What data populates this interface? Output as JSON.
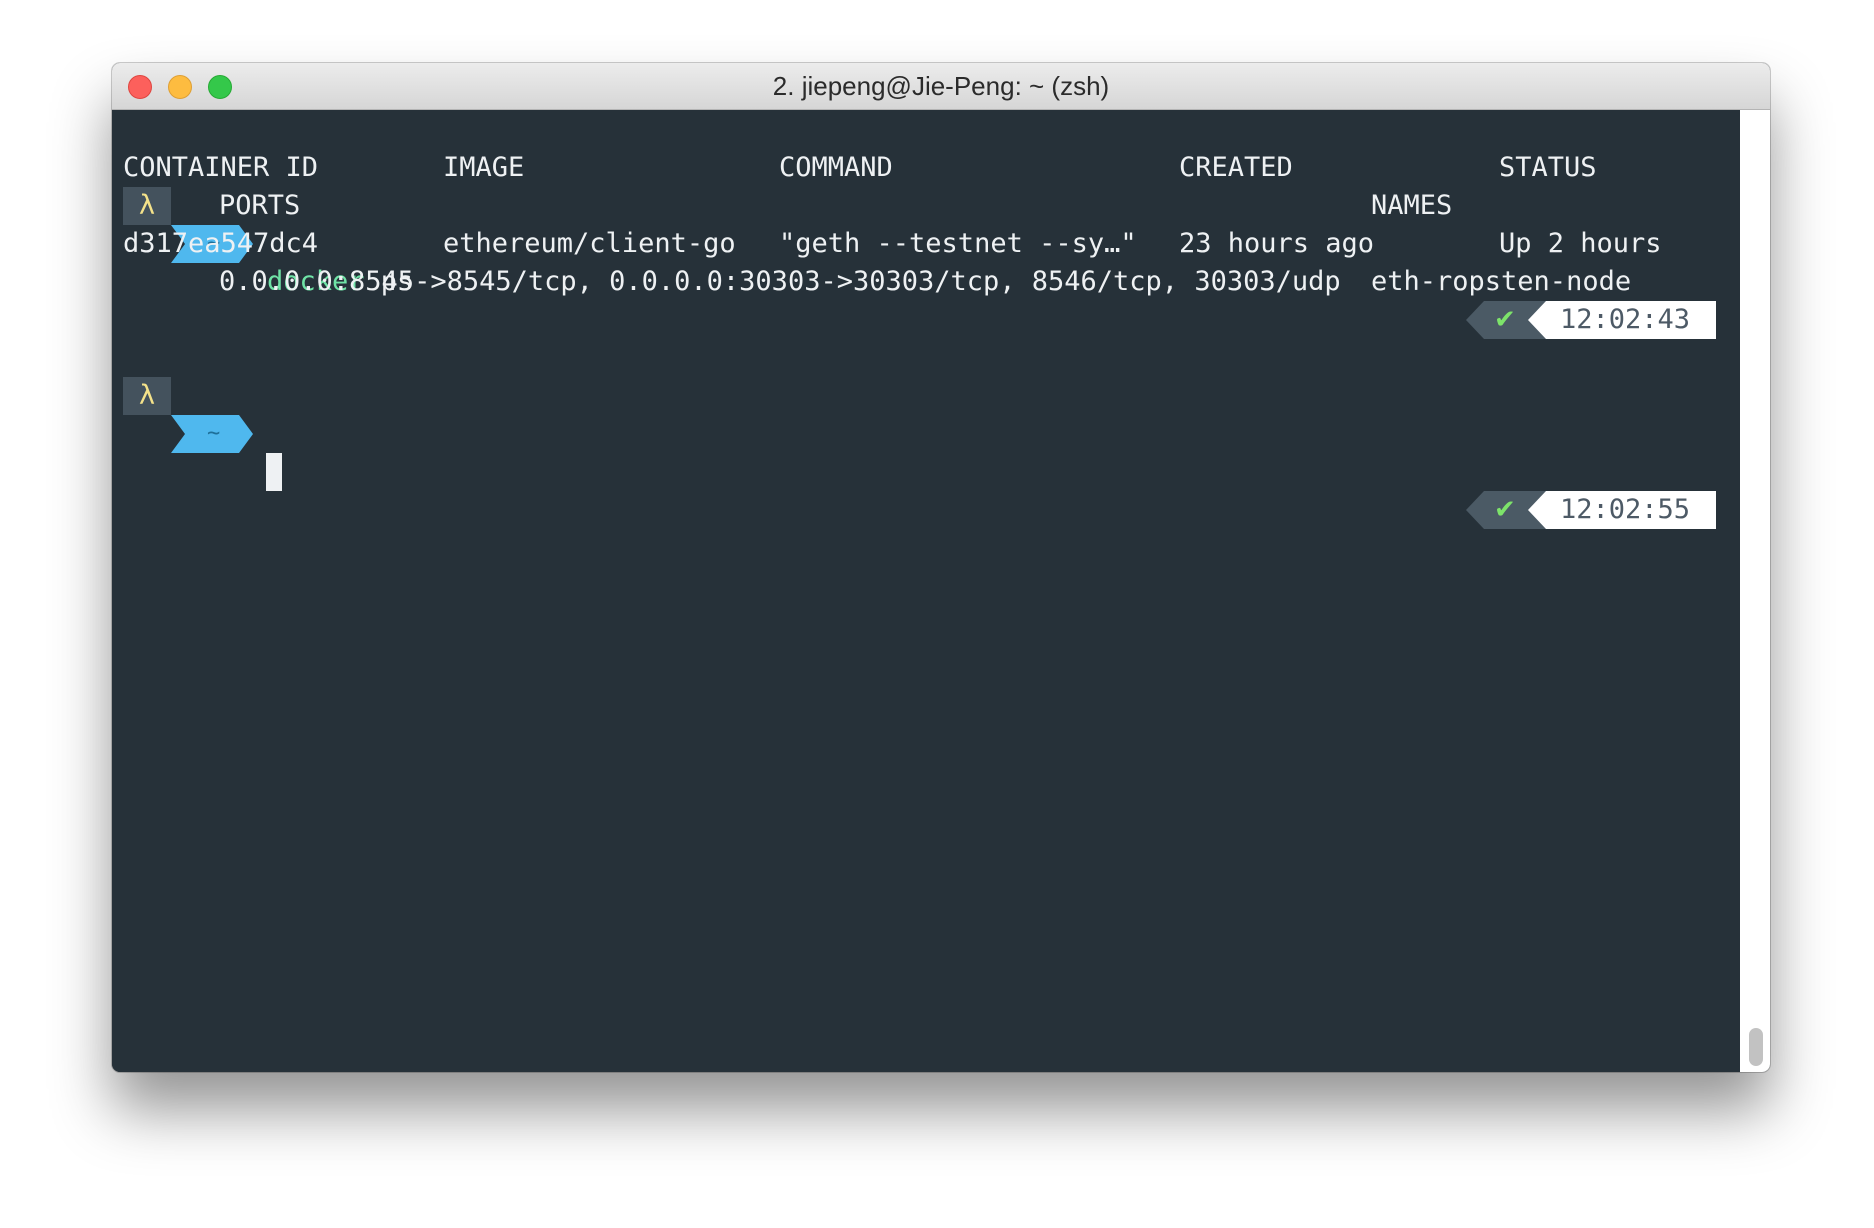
{
  "window": {
    "title": "2. jiepeng@Jie-Peng: ~ (zsh)"
  },
  "prompt": {
    "lambda": "λ",
    "dir": "~",
    "check": "✔"
  },
  "session": {
    "command_program": "docker",
    "command_args": " ps",
    "time_first": "12:02:43",
    "time_second": "12:02:55"
  },
  "table": {
    "headers": {
      "container_id": "CONTAINER ID",
      "image": "IMAGE",
      "command": "COMMAND",
      "created": "CREATED",
      "status": "STATUS",
      "ports": "PORTS",
      "names": "NAMES"
    },
    "row": {
      "container_id": "d317ea547dc4",
      "image": "ethereum/client-go",
      "command": "\"geth --testnet --sy…\"",
      "created": "23 hours ago",
      "status": "Up 2 hours",
      "ports": "0.0.0.0:8545->8545/tcp, 0.0.0.0:30303->30303/tcp, 8546/tcp, 30303/udp",
      "names": "eth-ropsten-node"
    }
  },
  "colors": {
    "terminal_bg": "#263139",
    "prompt_lambda_bg": "#44525d",
    "prompt_dir_bg": "#4fb8ee",
    "command_green": "#6fe3a6",
    "check_green": "#7de36a"
  }
}
